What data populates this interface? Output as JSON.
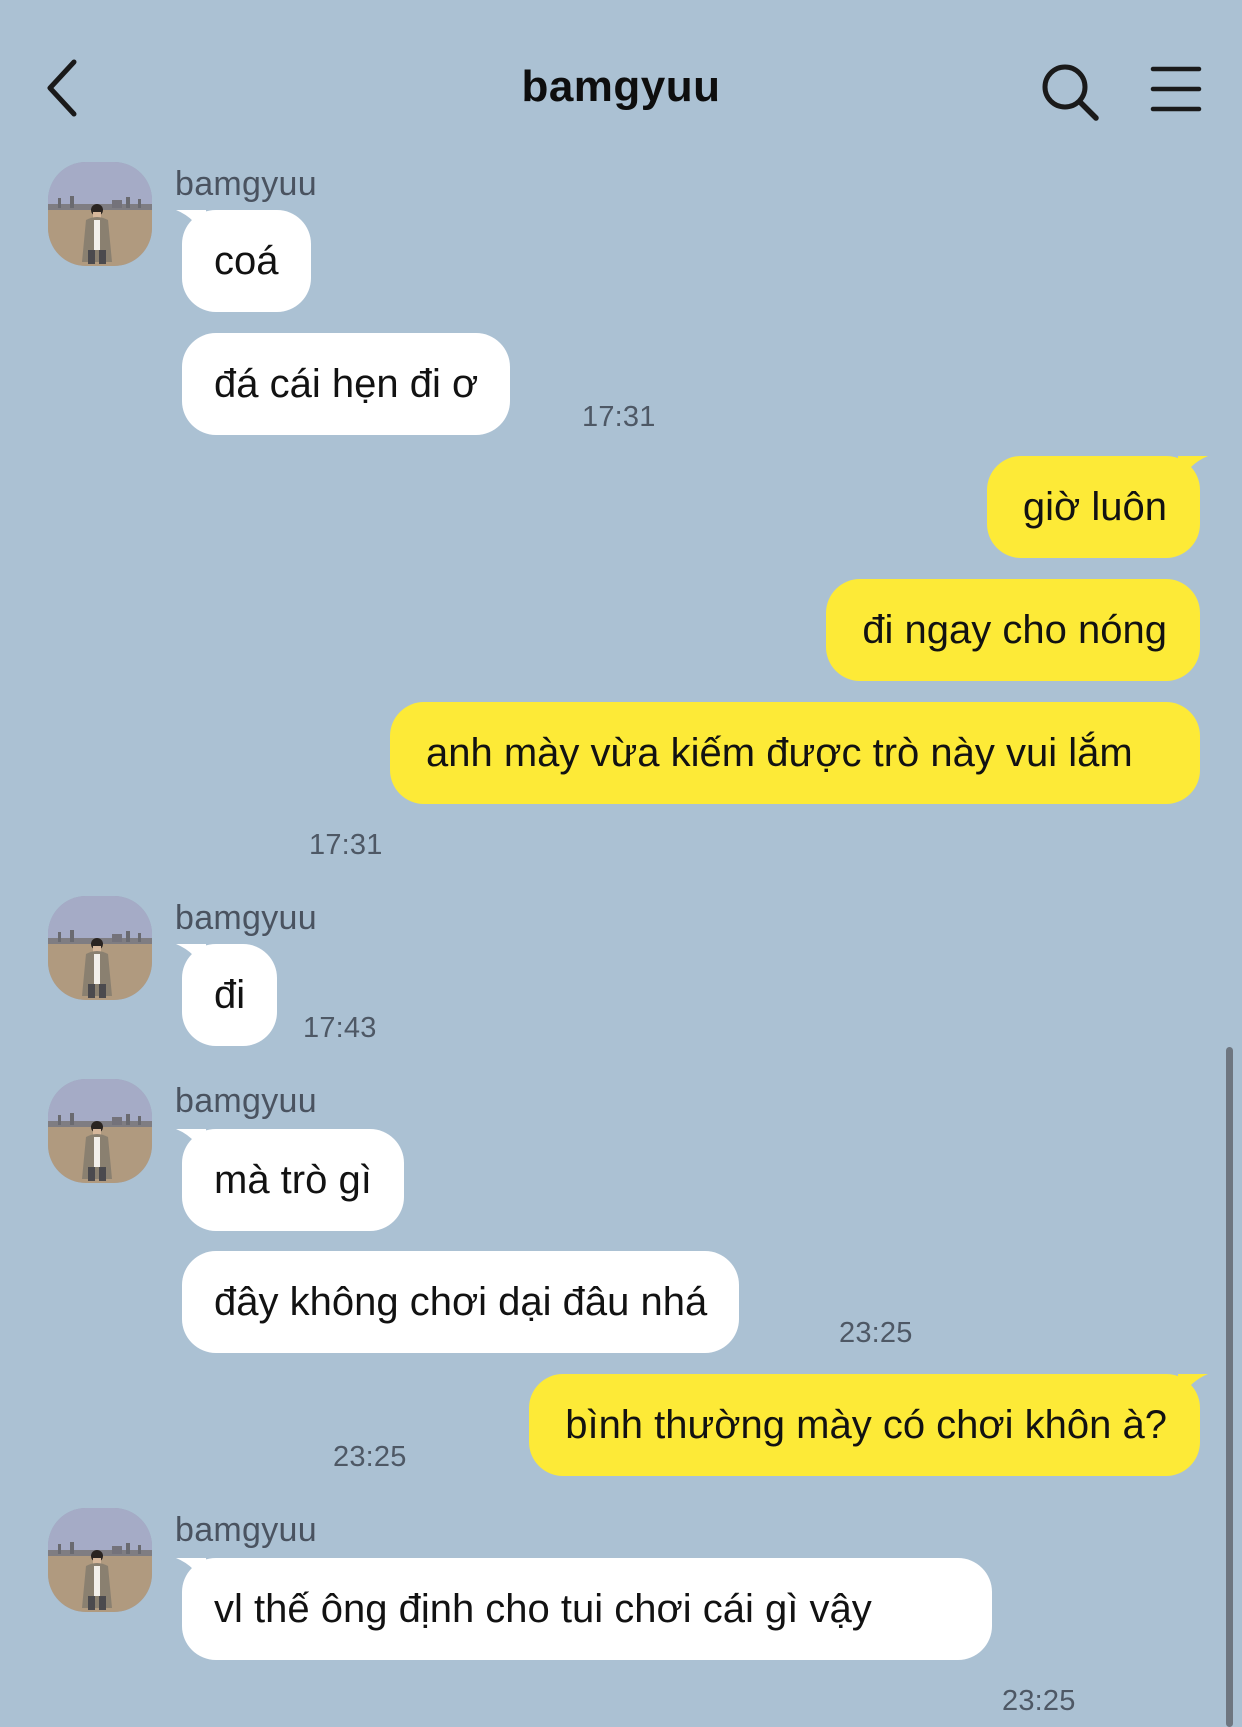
{
  "header": {
    "title": "bamgyuu"
  },
  "icons": {
    "back": "chevron-left-icon",
    "search": "search-icon",
    "menu": "hamburger-menu-icon"
  },
  "colors": {
    "background": "#abc1d3",
    "incoming_bubble": "#ffffff",
    "outgoing_bubble": "#fdea37"
  },
  "messages": [
    {
      "group": 1,
      "direction": "incoming",
      "sender": "bamgyuu",
      "bubbles": [
        "coá",
        "đá cái hẹn đi ơ"
      ],
      "time": "17:31"
    },
    {
      "group": 2,
      "direction": "outgoing",
      "bubbles": [
        "giờ luôn",
        "đi ngay cho nóng",
        "anh mày vừa kiếm được trò này vui lắm"
      ],
      "time": "17:31"
    },
    {
      "group": 3,
      "direction": "incoming",
      "sender": "bamgyuu",
      "bubbles": [
        "đi"
      ],
      "time": "17:43"
    },
    {
      "group": 4,
      "direction": "incoming",
      "sender": "bamgyuu",
      "bubbles": [
        "mà trò gì",
        "đây không chơi dại đâu nhá"
      ],
      "time": "23:25"
    },
    {
      "group": 5,
      "direction": "outgoing",
      "bubbles": [
        "bình thường mày có chơi khôn à?"
      ],
      "time": "23:25"
    },
    {
      "group": 6,
      "direction": "incoming",
      "sender": "bamgyuu",
      "bubbles": [
        "vl thế ông định cho tui chơi cái gì vậy"
      ],
      "time": "23:25"
    }
  ]
}
